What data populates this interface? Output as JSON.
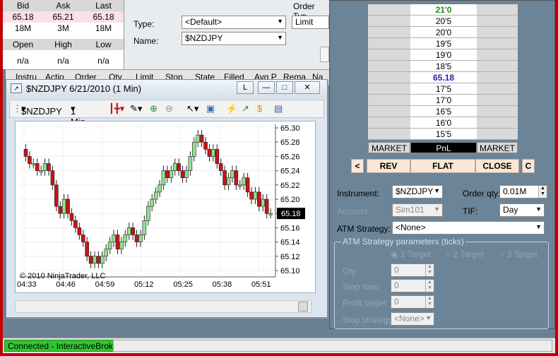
{
  "quote": {
    "headers": [
      "Bid",
      "Ask",
      "Last"
    ],
    "prices": [
      "65.18",
      "65.21",
      "65.18"
    ],
    "sizes": [
      "18M",
      "3M",
      "18M"
    ],
    "headers2": [
      "Open",
      "High",
      "Low"
    ],
    "values2": [
      "n/a",
      "n/a",
      "n/a"
    ]
  },
  "order_top": {
    "type_label": "Type:",
    "type_value": "<Default>",
    "name_label": "Name:",
    "name_value": "$NZDJPY",
    "ordertype_label": "Order Typ",
    "ordertype_value": "Limit"
  },
  "grid_columns": [
    "Instru",
    "Actio",
    "Order",
    "Qty",
    "Limit",
    "Stop",
    "State",
    "Filled",
    "Avg P",
    "Rema",
    "Na"
  ],
  "chart": {
    "title": "$NZDJPY  6/21/2010 (1 Min)",
    "buttons": [
      "L",
      "—",
      "□",
      "✕"
    ],
    "instrument": "$NZDJPY",
    "interval": "1 Min",
    "copyright": "© 2010 NinjaTrader, LLC",
    "last_price_label": "65.18"
  },
  "chart_data": {
    "type": "candlestick",
    "x_ticks": [
      "04:33",
      "04:46",
      "04:59",
      "05:12",
      "05:25",
      "05:38",
      "05:51"
    ],
    "y_ticks": [
      "65.30",
      "65.28",
      "65.26",
      "65.24",
      "65.22",
      "65.20",
      "65.18",
      "65.16",
      "65.14",
      "65.12",
      "65.10"
    ],
    "ylim": [
      65.095,
      65.305
    ],
    "closes": [
      65.26,
      65.25,
      65.25,
      65.24,
      65.24,
      65.25,
      65.24,
      65.22,
      65.19,
      65.18,
      65.2,
      65.18,
      65.17,
      65.16,
      65.15,
      65.14,
      65.12,
      65.11,
      65.12,
      65.11,
      65.12,
      65.13,
      65.14,
      65.15,
      65.13,
      65.14,
      65.15,
      65.16,
      65.15,
      65.14,
      65.15,
      65.17,
      65.19,
      65.2,
      65.21,
      65.22,
      65.24,
      65.23,
      65.24,
      65.25,
      65.24,
      65.23,
      65.24,
      65.26,
      65.28,
      65.29,
      65.28,
      65.27,
      65.26,
      65.27,
      65.25,
      65.24,
      65.22,
      65.23,
      65.24,
      65.22,
      65.22,
      65.23,
      65.21,
      65.2,
      65.21,
      65.19,
      65.2,
      65.18,
      65.18
    ],
    "up_color": "#90e090",
    "down_color": "#c81414"
  },
  "dom": {
    "ladder_prices": [
      "21'0",
      "20'5",
      "20'0",
      "19'5",
      "19'0",
      "18'5",
      "65.18",
      "17'5",
      "17'0",
      "16'5",
      "16'0",
      "15'5"
    ],
    "ladder_footer": [
      "MARKET",
      "PnL",
      "MARKET"
    ],
    "rev": "REV",
    "flat": "FLAT",
    "close": "CLOSE",
    "left_c": "<",
    "right_c": "C",
    "instrument_label": "Instrument:",
    "instrument_value": "$NZDJPY",
    "orderqty_label": "Order qty:",
    "orderqty_value": "0.01M",
    "account_label": "Account:",
    "account_value": "Sim101",
    "tif_label": "TIF:",
    "tif_value": "Day",
    "atm_label": "ATM Strategy:",
    "atm_value": "<None>",
    "params_title": "ATM Strategy parameters (ticks)",
    "targets": [
      "1 Target",
      "2 Target",
      "3 Target"
    ],
    "qty_label": "Qty:",
    "qty_value": "0",
    "stoploss_label": "Stop loss:",
    "stoploss_value": "0",
    "profit_label": "Profit target:",
    "profit_value": "0",
    "stopstrat_label": "Stop strategy:",
    "stopstrat_value": "<None>"
  },
  "status": {
    "connection": "Connected - InteractiveBrokers"
  }
}
